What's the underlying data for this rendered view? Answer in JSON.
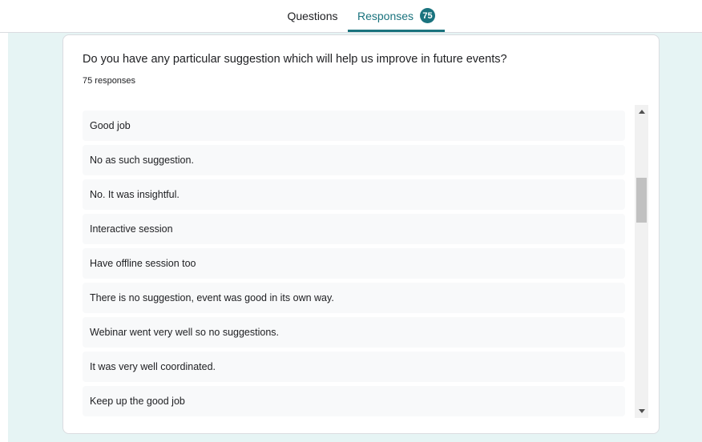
{
  "tabs": {
    "questions_label": "Questions",
    "responses_label": "Responses",
    "responses_count": "75"
  },
  "question": {
    "title": "Do you have any particular suggestion which will help us improve in future events?",
    "response_count": "75 responses",
    "responses": [
      "Good job",
      "No as such suggestion.",
      "No. It was insightful.",
      "Interactive session",
      "Have offline session too",
      "There is no suggestion, event was good in its own way.",
      "Webinar went very well so no suggestions.",
      "It was very well coordinated.",
      "Keep up the good job"
    ]
  },
  "colors": {
    "accent": "#1a737e",
    "page_background": "#e6f4f4",
    "item_background": "#f8f9fa"
  }
}
